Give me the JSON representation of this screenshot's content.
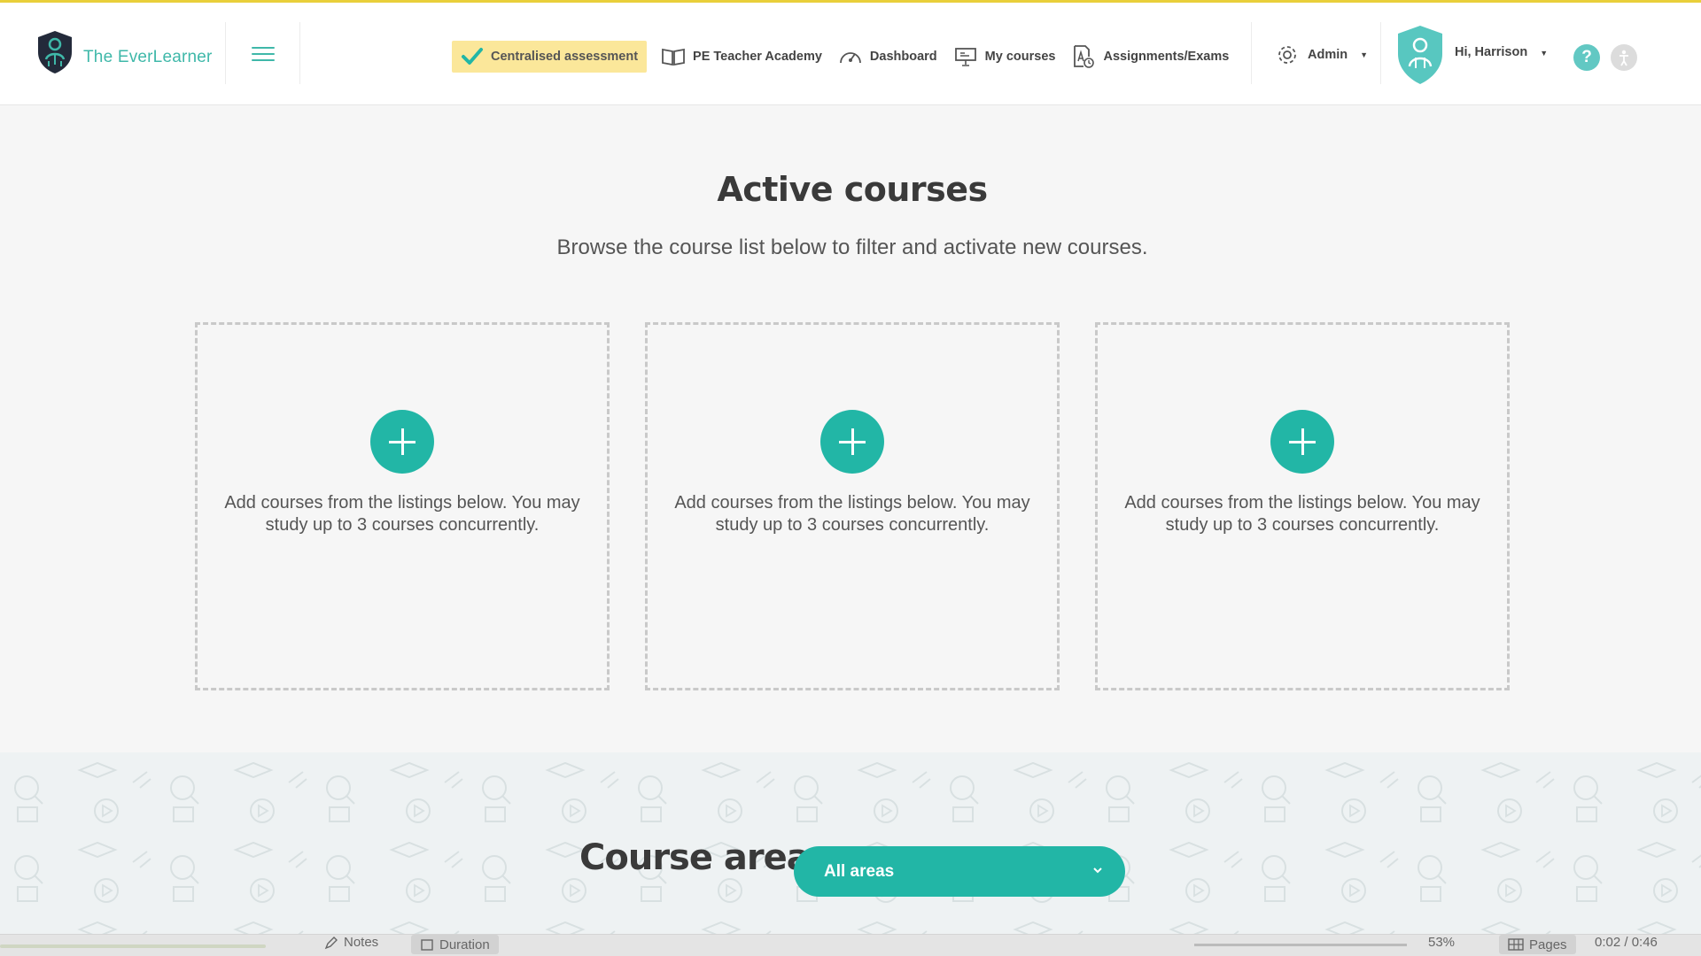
{
  "brand": {
    "name": "The EverLearner"
  },
  "nav": {
    "items": [
      {
        "label": "Centralised assessment",
        "icon": "checkmark-icon"
      },
      {
        "label": "PE Teacher Academy",
        "icon": "book-icon"
      },
      {
        "label": "Dashboard",
        "icon": "gauge-icon"
      },
      {
        "label": "My courses",
        "icon": "presentation-board-icon"
      },
      {
        "label": "Assignments/Exams",
        "icon": "document-clock-icon"
      }
    ],
    "admin_label": "Admin",
    "user_greeting": "Hi, Harrison",
    "help_label": "?"
  },
  "main": {
    "title": "Active courses",
    "subtitle": "Browse the course list below to filter and activate new courses.",
    "slots": [
      {
        "text": "Add courses from the listings below. You may study up to 3 courses concurrently."
      },
      {
        "text": "Add courses from the listings below. You may study up to 3 courses concurrently."
      },
      {
        "text": "Add courses from the listings below. You may study up to 3 courses concurrently."
      }
    ]
  },
  "course_area": {
    "label": "Course area",
    "selected": "All areas"
  },
  "bottom_bar": {
    "notes": "Notes",
    "duration": "Duration",
    "zoom": "53%",
    "pages": "Pages",
    "time": "0:02 / 0:46"
  },
  "colors": {
    "accent_teal": "#22b6a6",
    "brand_teal": "#3fb8a9",
    "highlight_yellow": "#fbe79a",
    "top_line": "#e9cf3a"
  }
}
